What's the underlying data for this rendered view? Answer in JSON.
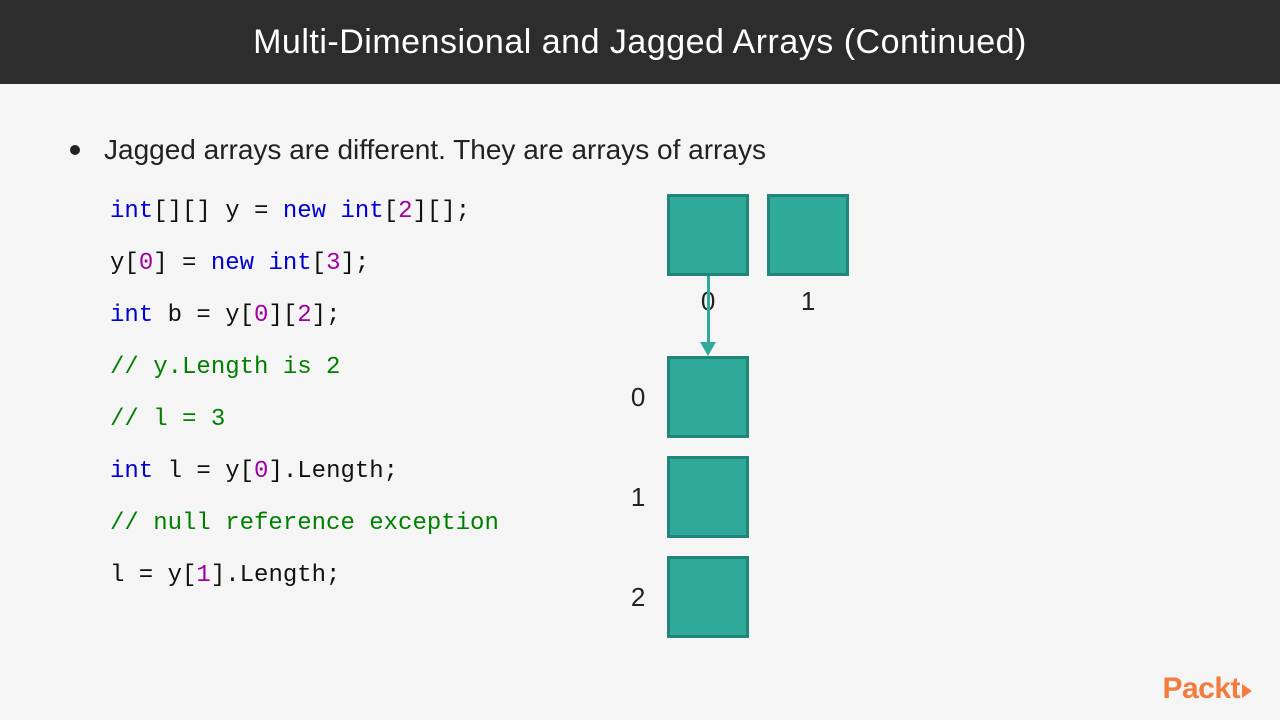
{
  "header": {
    "title": "Multi-Dimensional and Jagged Arrays (Continued)"
  },
  "bullet": {
    "text": "Jagged arrays are different. They are arrays of arrays"
  },
  "code": {
    "l1_a": "int",
    "l1_b": "[][] y = ",
    "l1_c": "new int",
    "l1_d": "[",
    "l1_e": "2",
    "l1_f": "][];",
    "l2_a": "y[",
    "l2_b": "0",
    "l2_c": "] = ",
    "l2_d": "new int",
    "l2_e": "[",
    "l2_f": "3",
    "l2_g": "];",
    "l3_a": "int",
    "l3_b": " b = y[",
    "l3_c": "0",
    "l3_d": "][",
    "l3_e": "2",
    "l3_f": "];",
    "l4": "// y.Length is 2",
    "l5": "// l = 3",
    "l6_a": "int",
    "l6_b": " l = y[",
    "l6_c": "0",
    "l6_d": "].Length;",
    "l7": "// null reference exception",
    "l8_a": "l = y[",
    "l8_b": "1",
    "l8_c": "].Length;"
  },
  "diagram": {
    "top_labels": [
      "0",
      "1"
    ],
    "side_labels": [
      "0",
      "1",
      "2"
    ]
  },
  "brand": {
    "name": "Packt"
  }
}
